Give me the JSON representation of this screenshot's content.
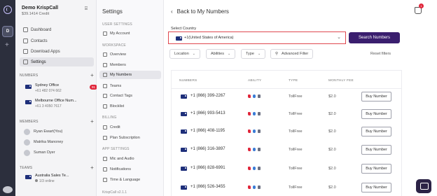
{
  "account": {
    "name": "Demo KrispCall",
    "credit": "$39.1414 Credit"
  },
  "workspace": {
    "initial": "D"
  },
  "sidebar": {
    "nav": [
      {
        "label": "Dashboard",
        "icon": "dashboard-icon"
      },
      {
        "label": "Contacts",
        "icon": "contacts-icon"
      },
      {
        "label": "Download Apps",
        "icon": "download-icon"
      },
      {
        "label": "Settings",
        "icon": "settings-icon",
        "active": true
      }
    ],
    "numbers_heading": "NUMBERS",
    "numbers": [
      {
        "name": "Sydney Office",
        "phone": "+61 482 074 662",
        "badge": "91"
      },
      {
        "name": "Melbourne Office Num...",
        "phone": "+61 3 4050 7617"
      }
    ],
    "members_heading": "MEMBERS",
    "members": [
      {
        "name": "Ryan Ewart(You)"
      },
      {
        "name": "Matrika Manoney"
      },
      {
        "name": "Suman Dyer"
      }
    ],
    "teams_heading": "TEAMS",
    "teams": [
      {
        "name": "Australia Sales Te...",
        "status": "1/3 online"
      }
    ]
  },
  "settings": {
    "title": "Settings",
    "groups": [
      {
        "heading": "USER SETTINGS",
        "items": [
          {
            "label": "My Account"
          }
        ]
      },
      {
        "heading": "WORKSPACE",
        "items": [
          {
            "label": "Overview"
          },
          {
            "label": "Members"
          },
          {
            "label": "My Numbers",
            "active": true
          },
          {
            "label": "Teams"
          },
          {
            "label": "Contact Tags"
          },
          {
            "label": "Blocklist"
          }
        ]
      },
      {
        "heading": "BILLING",
        "items": [
          {
            "label": "Credit"
          },
          {
            "label": "Plan Subscription"
          }
        ]
      },
      {
        "heading": "APP SETTINGS",
        "items": [
          {
            "label": "Mic and Audio"
          },
          {
            "label": "Notifications"
          },
          {
            "label": "Time & Language"
          }
        ]
      }
    ],
    "version": "KrispCall v2.1.1"
  },
  "main": {
    "back_label": "Back to My Numbers",
    "cart_count": "1",
    "select_label": "Select Country",
    "country_value": "+1(United States of America)",
    "search_button": "Search Numbers",
    "filters": [
      "Location",
      "Abilities",
      "Type"
    ],
    "advanced_filter": "Advanced Filter",
    "reset_filters": "Reset filters",
    "columns": [
      "NUMBERS",
      "ABILITY",
      "TYPE",
      "MONTHLY FEE"
    ],
    "rows": [
      {
        "number": "+1 (866) 399-2267",
        "type": "TollFree",
        "fee": "$2.0",
        "action": "Buy Number"
      },
      {
        "number": "+1 (866) 993-5413",
        "type": "TollFree",
        "fee": "$2.0",
        "action": "Buy Number"
      },
      {
        "number": "+1 (866) 408-1195",
        "type": "TollFree",
        "fee": "$2.0",
        "action": "Buy Number"
      },
      {
        "number": "+1 (866) 316-3897",
        "type": "TollFree",
        "fee": "$2.0",
        "action": "Buy Number"
      },
      {
        "number": "+1 (866) 828-6991",
        "type": "TollFree",
        "fee": "$2.0",
        "action": "Buy Number"
      },
      {
        "number": "+1 (866) 526-3455",
        "type": "TollFree",
        "fee": "$2.0",
        "action": "Buy Number"
      }
    ]
  },
  "colors": {
    "primary": "#3a1e6e",
    "alert": "#e0263b",
    "highlight_border": "#e04850"
  }
}
